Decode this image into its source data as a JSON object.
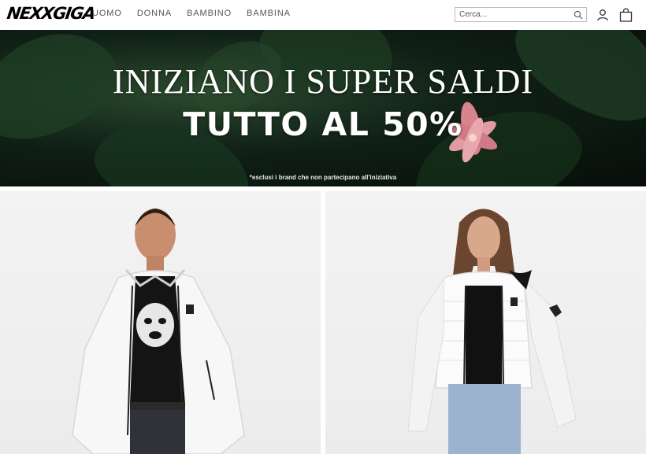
{
  "header": {
    "logo_text": "NEXXGIGA",
    "nav": [
      "UOMO",
      "DONNA",
      "BAMBINO",
      "BAMBINA"
    ],
    "search_placeholder": "Cerca...",
    "icons": [
      "search-icon",
      "user-icon",
      "bag-icon"
    ]
  },
  "banner": {
    "line1": "INIZIANO I SUPER SALDI",
    "line2": "TUTTO AL 50%",
    "note": "*esclusi i brand che non partecipano all'iniziativa"
  },
  "products": [
    {
      "label": "man-white-jacket"
    },
    {
      "label": "woman-white-puffer-jacket"
    }
  ],
  "colors": {
    "accent": "#000000",
    "nav_text": "#555555",
    "banner_bg": "#102016",
    "tile_bg": "#efefef"
  }
}
